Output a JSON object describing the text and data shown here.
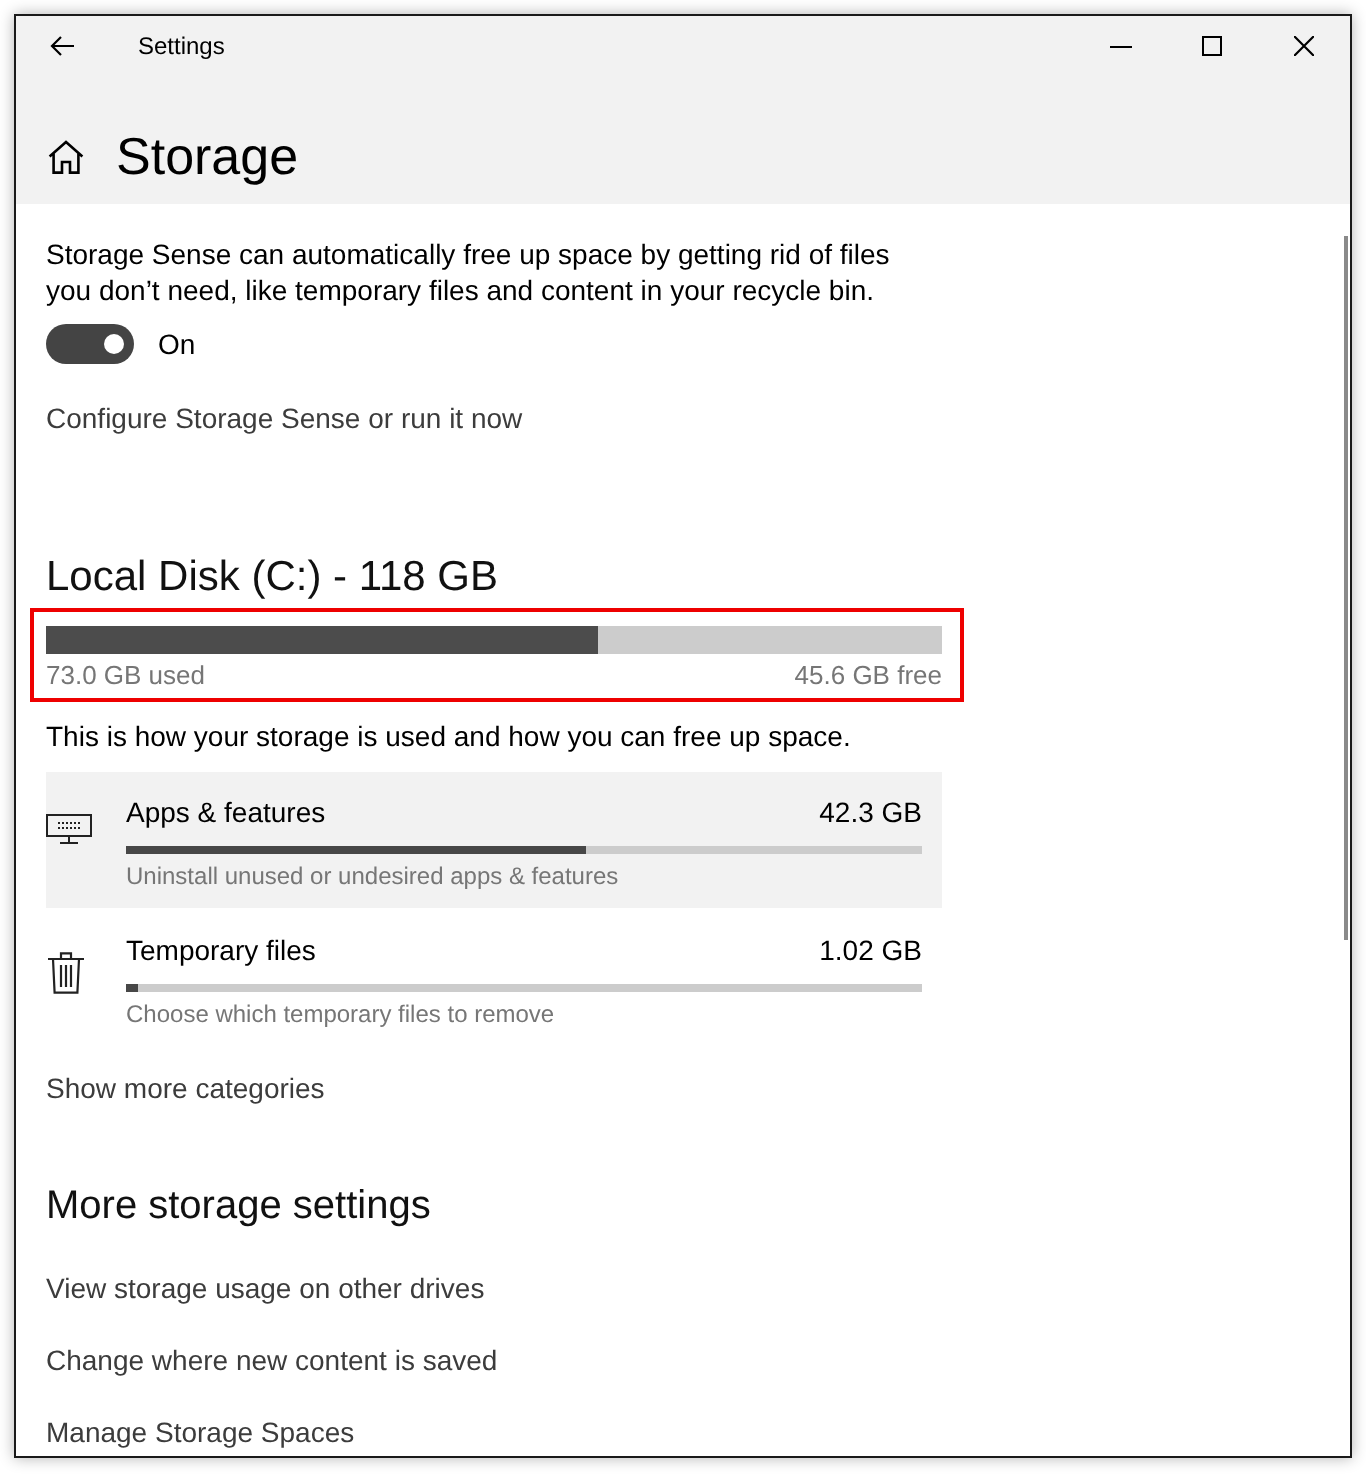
{
  "window": {
    "title": "Settings"
  },
  "page": {
    "title": "Storage"
  },
  "storage_sense": {
    "description": "Storage Sense can automatically free up space by getting rid of files you don’t need, like temporary files and content in your recycle bin.",
    "toggle": {
      "on": true,
      "label": "On"
    },
    "link": "Configure Storage Sense or run it now"
  },
  "disk": {
    "title": "Local Disk (C:) - 118 GB",
    "outlined": true,
    "level": 0.616,
    "used": "73.0 GB used",
    "free": "45.6 GB free"
  },
  "usage_note": "This is how your storage is used and how you can free up space.",
  "categories": [
    {
      "kind": "apps",
      "name": "Apps & features",
      "size": "42.3 GB",
      "level": 0.578,
      "description": "Uninstall unused or undesired apps & features",
      "hovered": true
    },
    {
      "kind": "temporary",
      "name": "Temporary files",
      "size": "1.02 GB",
      "level": 0.015,
      "description": "Choose which temporary files to remove",
      "hovered": false
    }
  ],
  "show_more": "Show more categories",
  "more_settings": {
    "title": "More storage settings",
    "links": [
      "View storage usage on other drives",
      "Change where new content is saved",
      "Manage Storage Spaces"
    ]
  }
}
